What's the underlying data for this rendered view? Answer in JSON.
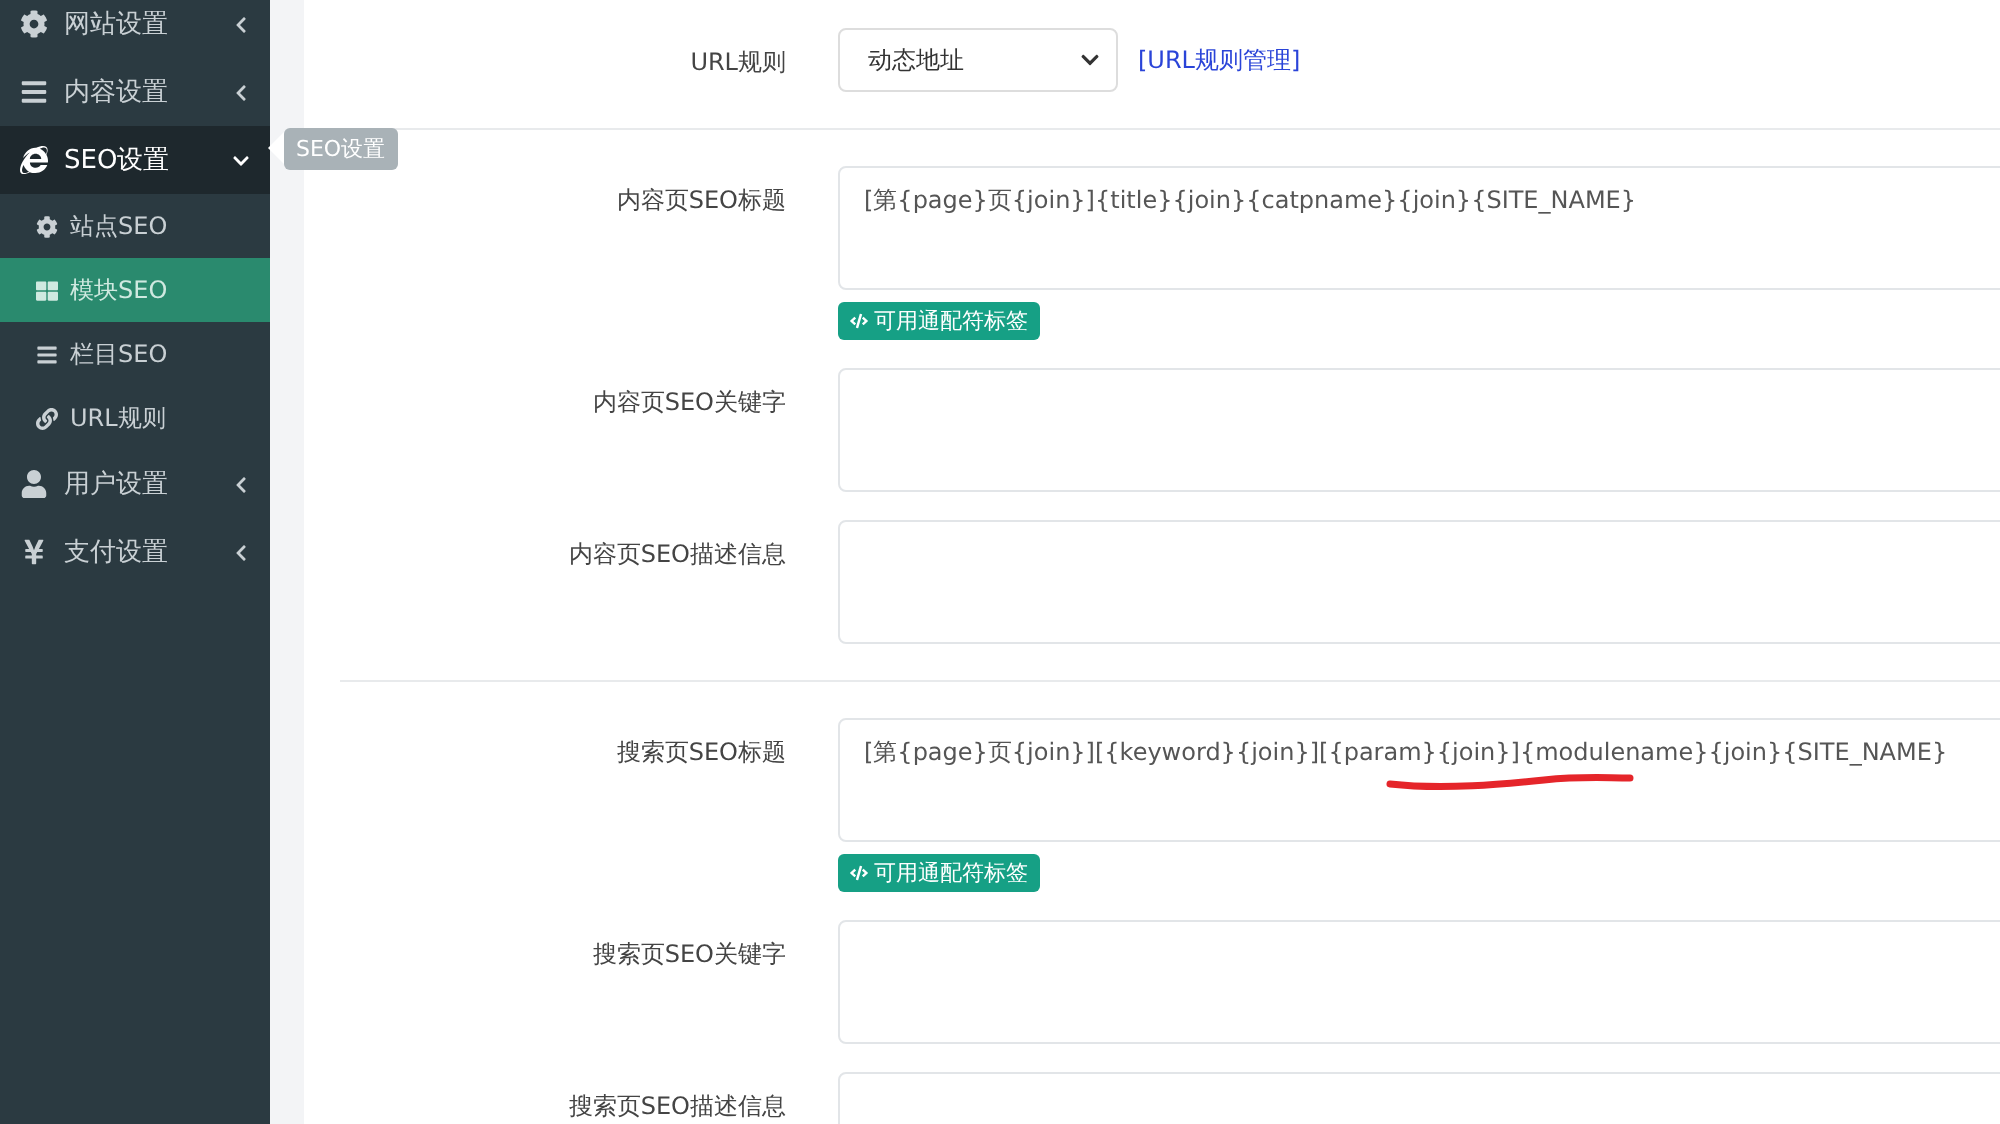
{
  "sidebar": {
    "items": [
      {
        "label": "网站设置",
        "expanded": false,
        "selected": false
      },
      {
        "label": "内容设置",
        "expanded": false,
        "selected": false
      },
      {
        "label": "SEO设置",
        "expanded": true,
        "selected": false,
        "children": [
          {
            "label": "站点SEO",
            "selected": false
          },
          {
            "label": "模块SEO",
            "selected": true
          },
          {
            "label": "栏目SEO",
            "selected": false
          },
          {
            "label": "URL规则",
            "selected": false
          }
        ]
      },
      {
        "label": "用户设置",
        "expanded": false,
        "selected": false
      },
      {
        "label": "支付设置",
        "expanded": false,
        "selected": false
      }
    ]
  },
  "tooltip": {
    "text": "SEO设置"
  },
  "url_rule": {
    "label": "URL规则",
    "value": "动态地址",
    "link": "[URL规则管理]"
  },
  "sections": [
    {
      "fields": [
        {
          "label": "内容页SEO标题",
          "value": "[第{page}页{join}]{title}{join}{catpname}{join}{SITE_NAME}",
          "tag_button": "可用通配符标签"
        },
        {
          "label": "内容页SEO关键字"
        },
        {
          "label": "内容页SEO描述信息"
        }
      ]
    },
    {
      "fields": [
        {
          "label": "搜索页SEO标题",
          "value": "[第{page}页{join}][{keyword}{join}][{param}{join}]{modulename}{join}{SITE_NAME}",
          "tag_button": "可用通配符标签",
          "underlined": true
        },
        {
          "label": "搜索页SEO关键字"
        },
        {
          "label": "搜索页SEO描述信息"
        }
      ]
    }
  ]
}
